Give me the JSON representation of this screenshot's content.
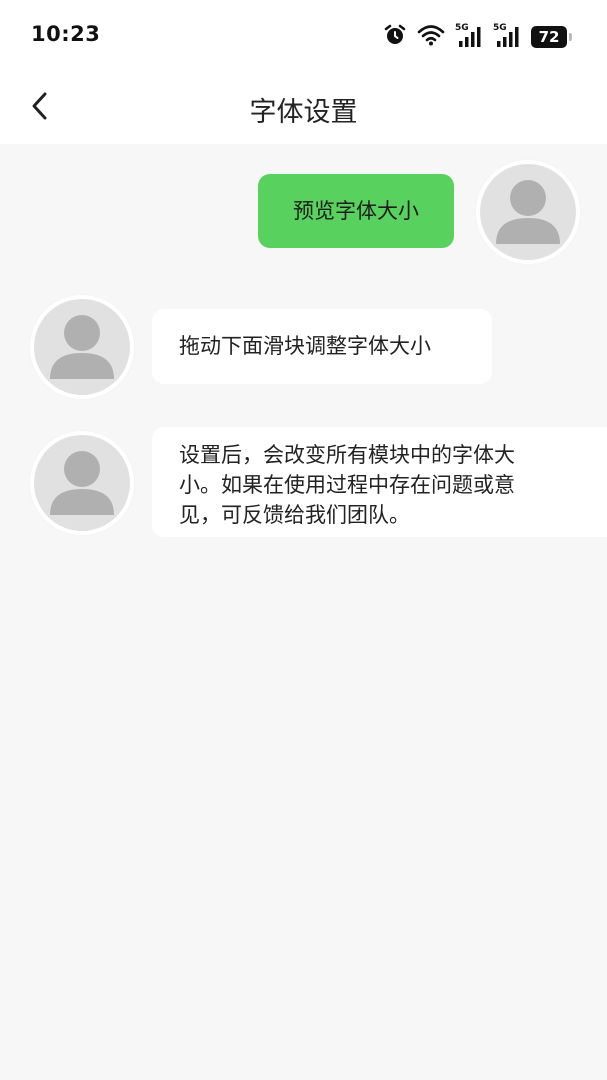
{
  "status_bar": {
    "time": "10:23",
    "battery_level": "72",
    "network_1": "5G",
    "network_2": "5G",
    "icons": [
      "alarm-icon",
      "wifi-icon",
      "signal-5g-icon",
      "signal-5g-icon",
      "battery-icon"
    ]
  },
  "nav": {
    "title": "字体设置",
    "back_icon": "chevron-left-icon"
  },
  "messages": [
    {
      "side": "right",
      "text": "预览字体大小",
      "bubble_color": "#59d15f"
    },
    {
      "side": "left",
      "text": "拖动下面滑块调整字体大小",
      "bubble_color": "#ffffff"
    },
    {
      "side": "left",
      "lines": [
        "设置后，会改变所有模块中的字体大",
        "小。如果在使用过程中存在问题或意",
        "见，可反馈给我们团队。"
      ],
      "bubble_color": "#ffffff"
    }
  ],
  "colors": {
    "accent": "#59d15f",
    "background": "#f7f7f7",
    "avatar_bg": "#e1e1e1",
    "avatar_figure": "#b0b0b0"
  }
}
